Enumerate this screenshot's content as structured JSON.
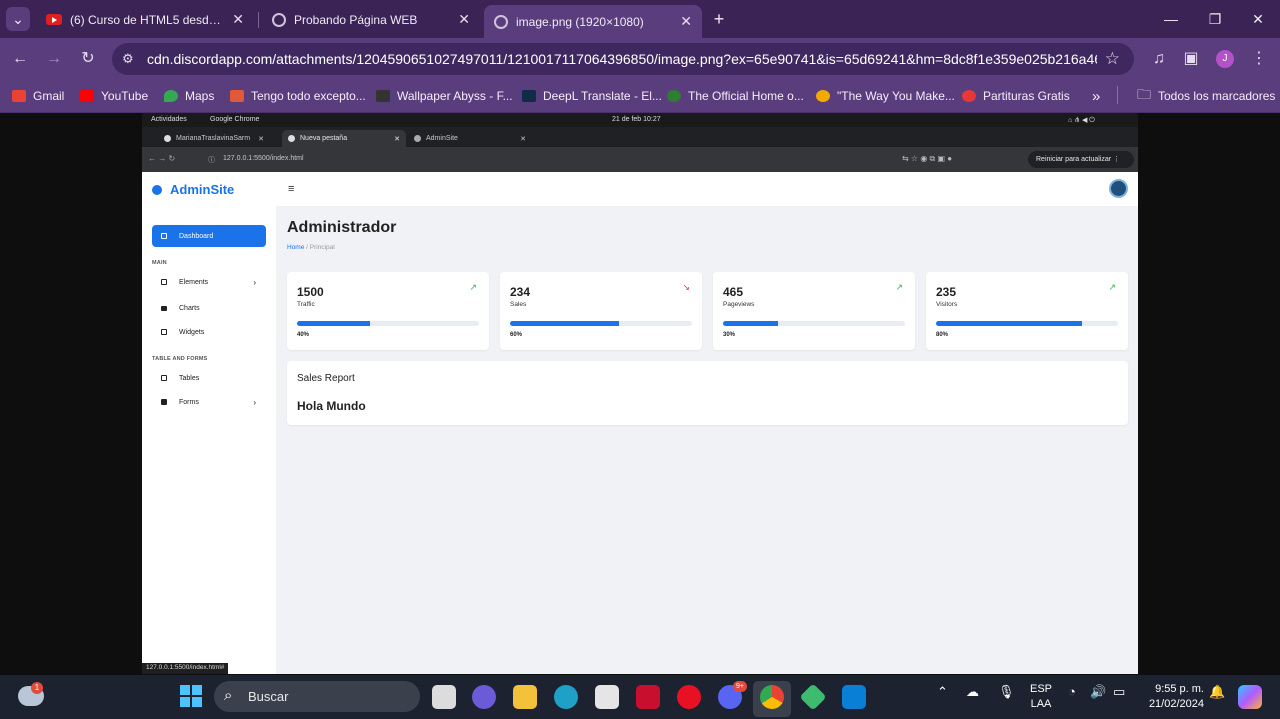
{
  "browser": {
    "tabs": [
      {
        "title": "(6) Curso de HTML5 desde CERO",
        "icon": "youtube-icon"
      },
      {
        "title": "Probando Página WEB",
        "icon": "globe-icon"
      },
      {
        "title": "image.png (1920×1080)",
        "icon": "globe-icon"
      }
    ],
    "new_tab": "+",
    "url": "cdn.discordapp.com/attachments/1204590651027497011/1210017117064396850/image.png?ex=65e90741&is=65d69241&hm=8dc8f1e359e025b216a46f34da4d...",
    "profile_initial": "J",
    "bookmarks": [
      {
        "label": "Gmail",
        "color": "#ea4335"
      },
      {
        "label": "YouTube",
        "color": "#ff0000"
      },
      {
        "label": "Maps",
        "color": "#34a853"
      },
      {
        "label": "Tengo todo excepto...",
        "color": "#e05a3a"
      },
      {
        "label": "Wallpaper Abyss - F...",
        "color": "#333333"
      },
      {
        "label": "DeepL Translate - El...",
        "color": "#0f2b46"
      },
      {
        "label": "The Official Home o...",
        "color": "#2e7d32"
      },
      {
        "label": "\"The Way You Make...",
        "color": "#f2a900"
      },
      {
        "label": "Partituras Gratis",
        "color": "#e53935"
      }
    ],
    "bookmarks_overflow": "»",
    "all_bookmarks": "Todos los marcadores"
  },
  "inner": {
    "gnome_activities": "Actividades",
    "gnome_app": "Google Chrome",
    "gnome_clock": "21 de feb  10:27",
    "tabs": [
      "MarianaTraslavinaSarm",
      "Nueva pestaña",
      "AdminSite"
    ],
    "url": "127.0.0.1:5500/index.html",
    "reload_label": "Reiniciar para actualizar",
    "status_url": "127.0.0.1:5500/index.html#"
  },
  "app": {
    "brand": "AdminSite",
    "menu_glyph": "≡",
    "nav": {
      "dashboard": "Dashboard",
      "section_main": "MAIN",
      "elements": "Elements",
      "charts": "Charts",
      "widgets": "Widgets",
      "section_tables": "TABLE AND FORMS",
      "tables": "Tables",
      "forms": "Forms"
    },
    "page_title": "Administrador",
    "breadcrumb": {
      "home": "Home",
      "sep": "/",
      "current": "Principal"
    },
    "cards": [
      {
        "value": "1500",
        "label": "Traffic",
        "percent": "40%",
        "progress": 0.4,
        "trend": "up",
        "trend_color": "#3ab54a"
      },
      {
        "value": "234",
        "label": "Sales",
        "percent": "60%",
        "progress": 0.6,
        "trend": "down",
        "trend_color": "#e53935"
      },
      {
        "value": "465",
        "label": "Pageviews",
        "percent": "30%",
        "progress": 0.3,
        "trend": "up",
        "trend_color": "#3ab54a"
      },
      {
        "value": "235",
        "label": "Visitors",
        "percent": "80%",
        "progress": 0.8,
        "trend": "up",
        "trend_color": "#3ab54a"
      }
    ],
    "report": {
      "title": "Sales Report",
      "body": "Hola Mundo"
    }
  },
  "taskbar": {
    "search_placeholder": "Buscar",
    "weather_badge": "1",
    "discord_badge": "9+",
    "lang_line1": "ESP",
    "lang_line2": "LAA",
    "time": "9:55 p. m.",
    "date": "21/02/2024"
  }
}
